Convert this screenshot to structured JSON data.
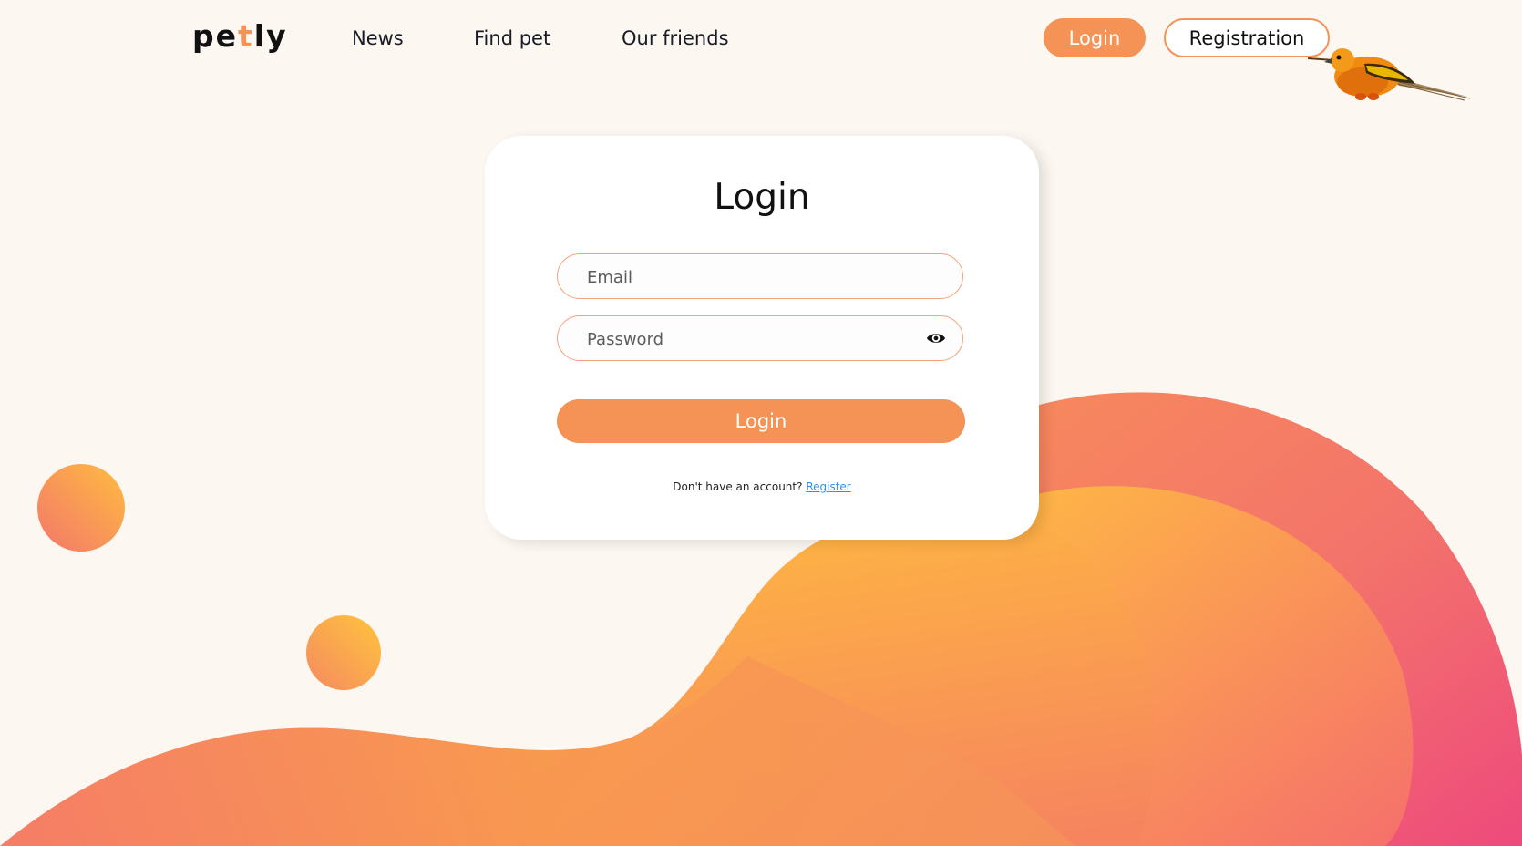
{
  "brand": {
    "logo_prefix": "pe",
    "logo_accent": "t",
    "logo_suffix": "ly",
    "accent_color": "#f59256"
  },
  "nav": {
    "items": [
      {
        "label": "News"
      },
      {
        "label": "Find pet"
      },
      {
        "label": "Our friends"
      }
    ]
  },
  "auth_nav": {
    "login_label": "Login",
    "register_label": "Registration"
  },
  "form": {
    "title": "Login",
    "email_placeholder": "Email",
    "email_value": "",
    "password_placeholder": "Password",
    "password_value": "",
    "password_toggle_icon": "eye-icon",
    "submit_label": "Login",
    "footer_text": "Don't have an account?",
    "footer_link": "Register"
  },
  "colors": {
    "background": "#fdf7f2",
    "primary": "#f59256",
    "link": "#3091eb",
    "wave_yellow": "#ffc33c",
    "wave_pink": "#f04c7a"
  }
}
